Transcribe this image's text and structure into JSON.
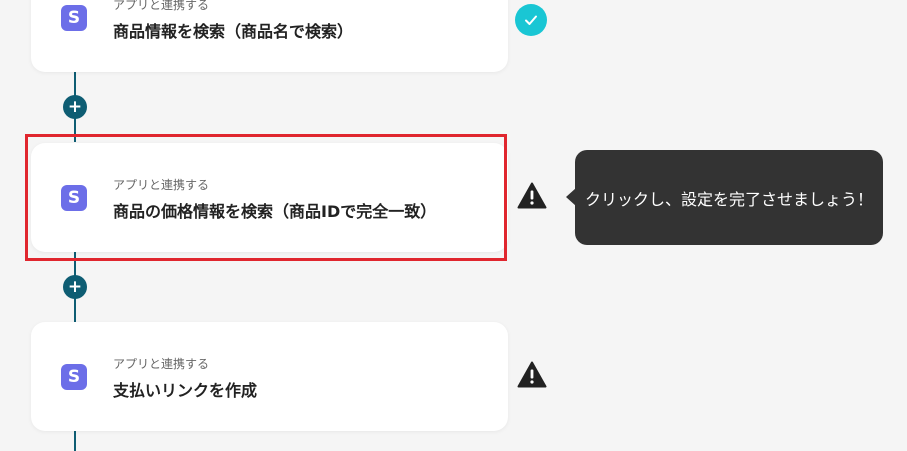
{
  "steps": [
    {
      "app_label": "アプリと連携する",
      "title": "商品情報を検索（商品名で検索）",
      "icon": "stripe-s-icon",
      "status": "completed"
    },
    {
      "app_label": "アプリと連携する",
      "title": "商品の価格情報を検索（商品IDで完全一致）",
      "icon": "stripe-s-icon",
      "status": "warning"
    },
    {
      "app_label": "アプリと連携する",
      "title": "支払いリンクを作成",
      "icon": "stripe-s-icon",
      "status": "warning"
    }
  ],
  "icon_letter": "S",
  "add_step_symbol": "+",
  "tooltip": {
    "text": "クリックし、設定を完了させましょう！"
  },
  "colors": {
    "background": "#f5f5f5",
    "connector": "#0e5d73",
    "app_icon": "#6c6ee8",
    "check": "#19c6d4",
    "highlight": "#e0262e",
    "tooltip_bg": "#333333",
    "warning": "#222222"
  }
}
